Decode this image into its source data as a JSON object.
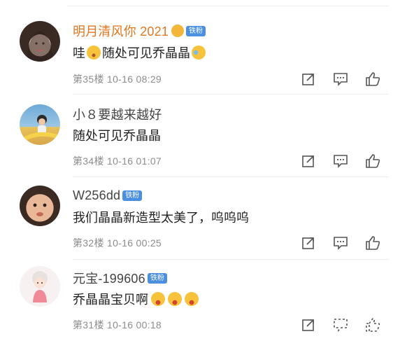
{
  "comments": [
    {
      "username": "明月清风你 2021",
      "username_color": "#e3771f",
      "badge": "铁粉",
      "content_parts": [
        "哇",
        "随处可见乔晶晶"
      ],
      "floor_label": "第35楼",
      "timestamp": "10-16 08:29",
      "avatar_style": "girl-dark-hair"
    },
    {
      "username": "小８要越来越好",
      "username_color": "#444444",
      "badge": "",
      "content_parts": [
        "随处可见乔晶晶"
      ],
      "floor_label": "第34楼",
      "timestamp": "10-16 01:07",
      "avatar_style": "child-on-slide"
    },
    {
      "username": "W256dd",
      "username_color": "#444444",
      "badge": "铁粉",
      "content_parts": [
        "我们晶晶新造型太美了，呜呜呜"
      ],
      "floor_label": "第32楼",
      "timestamp": "10-16 00:25",
      "avatar_style": "baby-face"
    },
    {
      "username": "元宝-199606",
      "username_color": "#444444",
      "badge": "铁粉",
      "content_parts": [
        "乔晶晶宝贝啊"
      ],
      "floor_label": "第31楼",
      "timestamp": "10-16 00:18",
      "avatar_style": "cartoon-girl"
    }
  ],
  "icons": {
    "share": "share-icon",
    "comment": "comment-icon",
    "like": "like-icon",
    "colors": {
      "icon_stroke": "#555555",
      "badge_bg": "#4a8fe0",
      "emoji_yellow": "#f7c33c"
    }
  }
}
